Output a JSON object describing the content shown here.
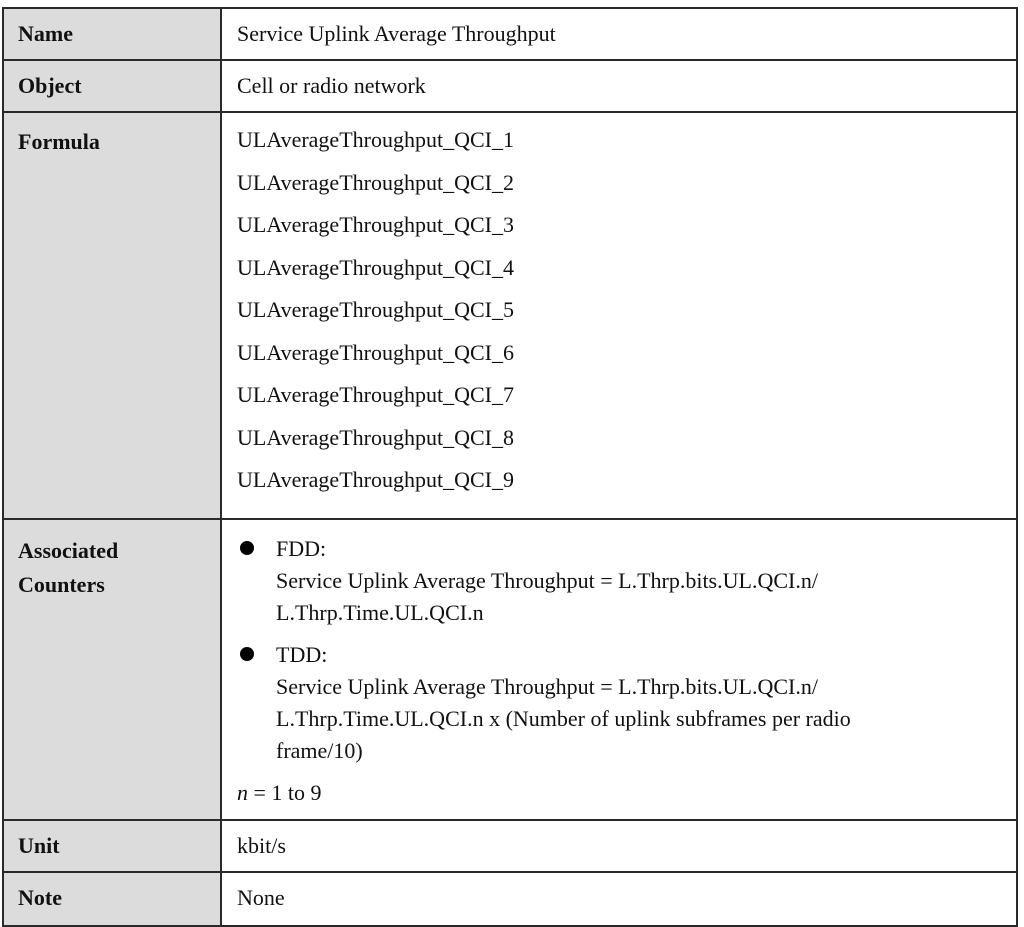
{
  "table": {
    "rows": {
      "name": {
        "label": "Name",
        "value": "Service Uplink Average Throughput"
      },
      "object": {
        "label": "Object",
        "value": "Cell or radio network"
      },
      "formula": {
        "label": "Formula",
        "values": [
          "ULAverageThroughput_QCI_1",
          "ULAverageThroughput_QCI_2",
          "ULAverageThroughput_QCI_3",
          "ULAverageThroughput_QCI_4",
          "ULAverageThroughput_QCI_5",
          "ULAverageThroughput_QCI_6",
          "ULAverageThroughput_QCI_7",
          "ULAverageThroughput_QCI_8",
          "ULAverageThroughput_QCI_9"
        ]
      },
      "associated_counters": {
        "label_line1": "Associated",
        "label_line2": "Counters",
        "bullets": [
          {
            "title": "FDD:",
            "lines": [
              "Service Uplink Average Throughput = L.Thrp.bits.UL.QCI.n/",
              "L.Thrp.Time.UL.QCI.n"
            ]
          },
          {
            "title": "TDD:",
            "lines": [
              "Service Uplink Average Throughput = L.Thrp.bits.UL.QCI.n/",
              "L.Thrp.Time.UL.QCI.n x (Number of uplink subframes per radio",
              "frame/10)"
            ]
          }
        ],
        "n_var": "n",
        "n_range": " = 1 to 9"
      },
      "unit": {
        "label": "Unit",
        "value": "kbit/s"
      },
      "note": {
        "label": "Note",
        "value": "None"
      }
    }
  }
}
